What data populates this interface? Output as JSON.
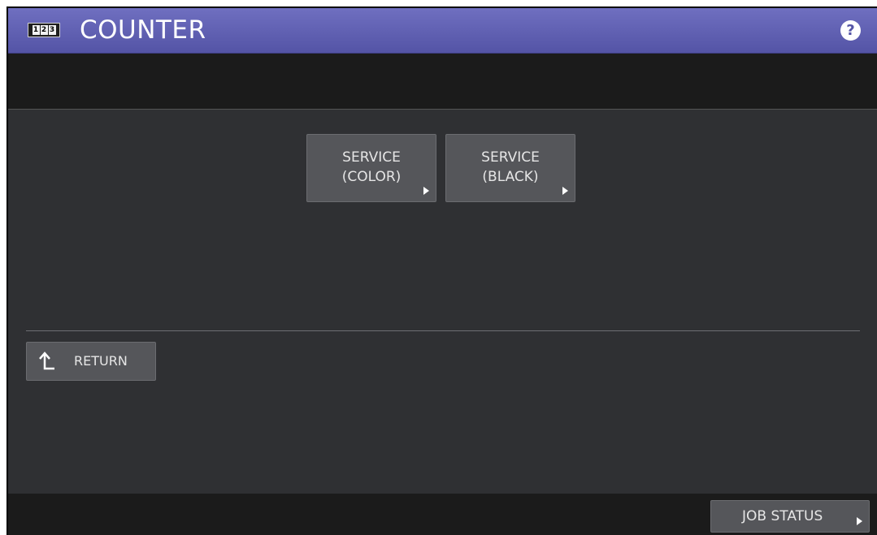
{
  "header": {
    "counter_icon_digits": [
      "1",
      "2",
      "3"
    ],
    "title": "COUNTER",
    "help_glyph": "?",
    "icons": {
      "counter": "counter-icon",
      "help": "help-icon"
    }
  },
  "main": {
    "buttons": [
      {
        "line1": "SERVICE",
        "line2": "(COLOR)"
      },
      {
        "line1": "SERVICE",
        "line2": "(BLACK)"
      }
    ]
  },
  "return_button": {
    "label": "RETURN",
    "icon": "return-arrow-icon"
  },
  "footer": {
    "job_status_label": "JOB STATUS"
  },
  "colors": {
    "title_bar": "#5c5cae",
    "background": "#2f3033",
    "button": "#55565a",
    "bar": "#1b1b1b"
  }
}
